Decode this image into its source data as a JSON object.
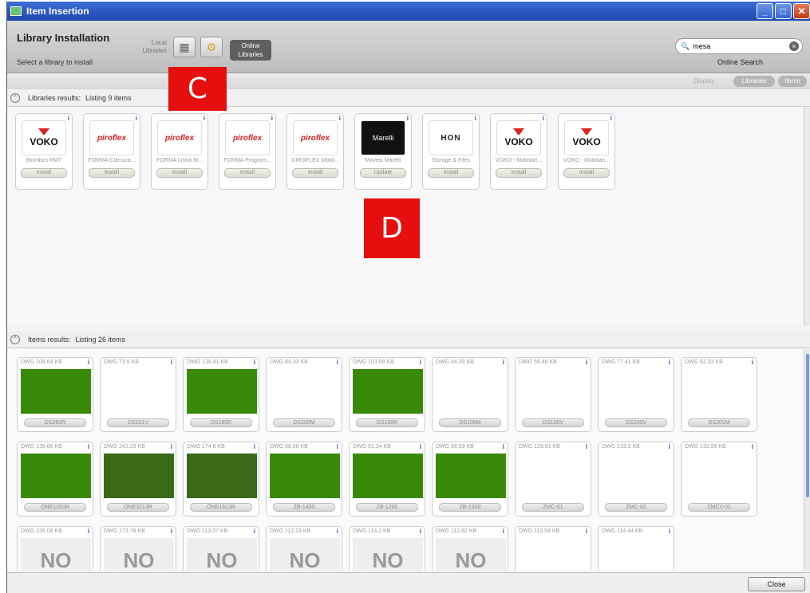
{
  "window": {
    "title": "Item Insertion"
  },
  "header": {
    "title": "Library Installation",
    "subtitle": "Select a library to install",
    "local_label": "Local Libraries",
    "online_label": "Online Libraries",
    "search_value": "mesa",
    "online_search_label": "Online Search"
  },
  "display": {
    "label": "Display:",
    "libraries": "Libraries",
    "items": "Items"
  },
  "libraries_section": {
    "label": "Libraries results:",
    "count": "Listing 9 items"
  },
  "libraries": [
    {
      "logo": "VOKO",
      "name": "Biombos RMT",
      "action": "Install"
    },
    {
      "logo": "piroflex",
      "name": "FORMA Clássica...",
      "action": "Install"
    },
    {
      "logo": "piroflex",
      "name": "FORMA Linha M...",
      "action": "Install"
    },
    {
      "logo": "piroflex",
      "name": "FORMA Program...",
      "action": "Install"
    },
    {
      "logo": "piroflex",
      "name": "GIROFLEX Mobil...",
      "action": "Install"
    },
    {
      "logo": "Marelli",
      "name": "Móveis Marelli",
      "action": "Update"
    },
    {
      "logo": "HON",
      "name": "Storage & Files",
      "action": "Install"
    },
    {
      "logo": "VOKO",
      "name": "VOKO - Mobiliári...",
      "action": "Install"
    },
    {
      "logo": "VOKO",
      "name": "VOKO - Mobiliári...",
      "action": "Install"
    }
  ],
  "items_section": {
    "label": "Items results:",
    "count": "Listing 26 items"
  },
  "items": [
    {
      "meta": "DWG 108.64 KB",
      "code": "DS250R",
      "thumb": "green"
    },
    {
      "meta": "DWG 73.8 KB",
      "code": "DS201V",
      "thumb": "white"
    },
    {
      "meta": "DWG 139.41 KB",
      "code": "DS180R",
      "thumb": "green"
    },
    {
      "meta": "DWG 84.33 KB",
      "code": "DS200M",
      "thumb": "white"
    },
    {
      "meta": "DWG 103.58 KB",
      "code": "DS160R",
      "thumb": "green"
    },
    {
      "meta": "DWG 84.39 KB",
      "code": "DS100M",
      "thumb": "white"
    },
    {
      "meta": "DWG 56.48 KB",
      "code": "DS100V",
      "thumb": "white"
    },
    {
      "meta": "DWG 77.41 KB",
      "code": "DS200V",
      "thumb": "white"
    },
    {
      "meta": "DWG 62.33 KB",
      "code": "DS201M",
      "thumb": "white"
    },
    {
      "meta": "DWG 136.66 KB",
      "code": "ONE1200R",
      "thumb": "green"
    },
    {
      "meta": "DWG 242.29 KB",
      "code": "ONE3213R",
      "thumb": "dark"
    },
    {
      "meta": "DWG 174.6 KB",
      "code": "ONE1613R",
      "thumb": "dark"
    },
    {
      "meta": "DWG 88.56 KB",
      "code": "ZB-1400",
      "thumb": "green"
    },
    {
      "meta": "DWG 92.34 KB",
      "code": "ZB-1200",
      "thumb": "green"
    },
    {
      "meta": "DWG 88.59 KB",
      "code": "ZB-1600",
      "thumb": "green"
    },
    {
      "meta": "DWG 129.91 KB",
      "code": "ZMC-01",
      "thumb": "white"
    },
    {
      "meta": "DWG 133.2 KB",
      "code": "ZMC-02",
      "thumb": "white"
    },
    {
      "meta": "DWG 132.99 KB",
      "code": "ZMCV-01",
      "thumb": "white"
    },
    {
      "meta": "DWG 136.08 KB",
      "code": "",
      "thumb": "noimg"
    },
    {
      "meta": "DWG 173.78 KB",
      "code": "",
      "thumb": "noimg"
    },
    {
      "meta": "DWG 113.07 KB",
      "code": "",
      "thumb": "noimg"
    },
    {
      "meta": "DWG 112.23 KB",
      "code": "",
      "thumb": "noimg"
    },
    {
      "meta": "DWG 114.2 KB",
      "code": "",
      "thumb": "noimg"
    },
    {
      "meta": "DWG 112.82 KB",
      "code": "",
      "thumb": "noimg"
    },
    {
      "meta": "DWG 113.54 KB",
      "code": "",
      "thumb": "white"
    },
    {
      "meta": "DWG 114.44 KB",
      "code": "",
      "thumb": "white"
    }
  ],
  "noimage_text": "NO",
  "info_glyph": "i",
  "footer": {
    "close_label": "Close"
  },
  "annotations": {
    "c": "C",
    "d": "D"
  },
  "colors": {
    "accent": "#2a55c2",
    "badge": "#e60f0f",
    "thumb_green": "#3a8a0a"
  }
}
